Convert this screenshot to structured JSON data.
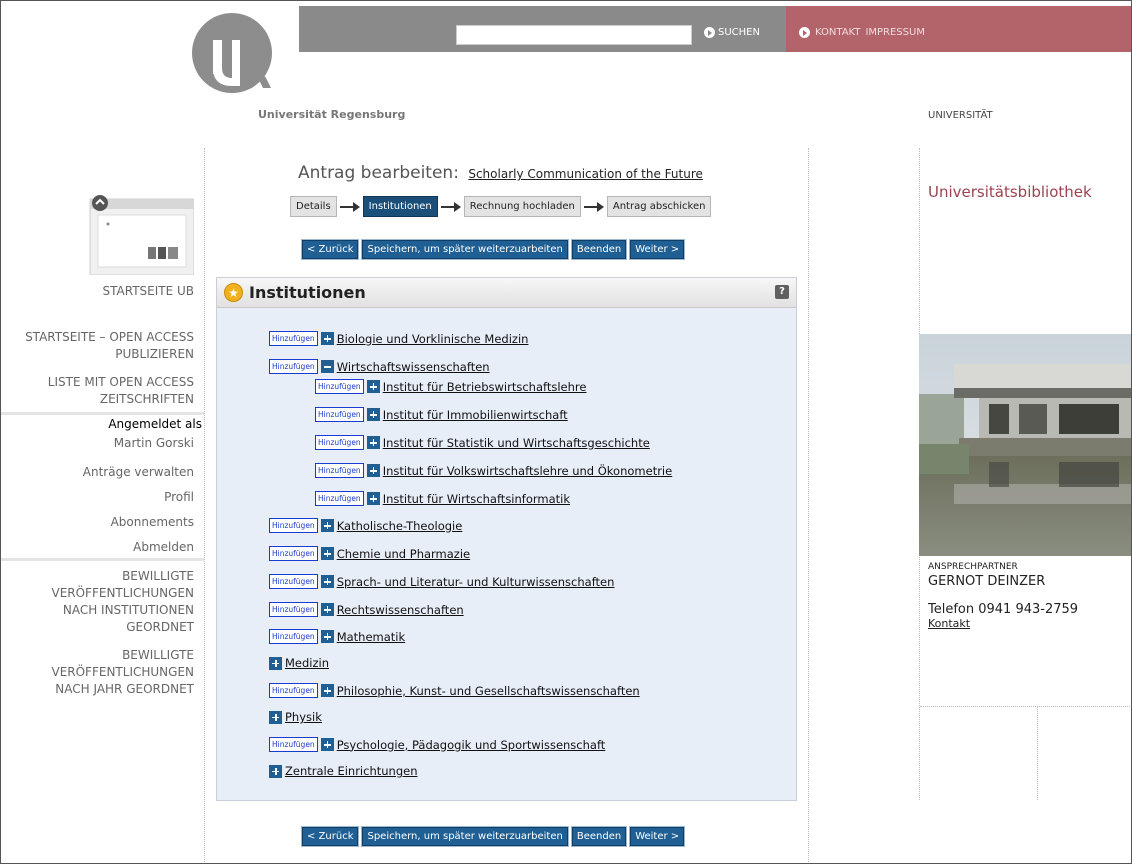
{
  "header": {
    "search_placeholder": "",
    "search_label": "SUCHEN",
    "kontakt_label": "KONTAKT",
    "impressum_label": "IMPRESSUM",
    "logo_text": "Universität Regensburg",
    "universitaet_label": "UNIVERSITÄT"
  },
  "sidebar": {
    "startseite_ub": "STARTSEITE UB",
    "oa_publizieren_1": "STARTSEITE – OPEN ACCESS",
    "oa_publizieren_2": "PUBLIZIEREN",
    "liste_1": "LISTE MIT OPEN ACCESS",
    "liste_2": "ZEITSCHRIFTEN",
    "angemeldet": "Angemeldet als",
    "user": "Martin Gorski",
    "antraege": "Anträge verwalten",
    "profil": "Profil",
    "abonnements": "Abonnements",
    "abmelden": "Abmelden",
    "bew_inst_1": "BEWILLIGTE",
    "bew_inst_2": "VERÖFFENTLICHUNGEN",
    "bew_inst_3": "NACH INSTITUTIONEN",
    "bew_inst_4": "GEORDNET",
    "bew_jahr_1": "BEWILLIGTE",
    "bew_jahr_2": "VERÖFFENTLICHUNGEN",
    "bew_jahr_3": "NACH JAHR GEORDNET"
  },
  "main": {
    "title_prefix": "Antrag bearbeiten:",
    "project_title": "Scholarly Communication of the Future",
    "steps": [
      "Details",
      "Institutionen",
      "Rechnung hochladen",
      "Antrag abschicken"
    ],
    "buttons": {
      "back": "< Zurück",
      "save_later": "Speichern, um später weiterzuarbeiten",
      "finish": "Beenden",
      "next": "Weiter >"
    },
    "panel_title": "Institutionen",
    "help": "?",
    "add_label": "Hinzufügen",
    "tree": [
      "Biologie und Vorklinische Medizin",
      "Wirtschaftswissenschaften",
      "Institut für Betriebswirtschaftslehre",
      "Institut für Immobilienwirtschaft",
      "Institut für Statistik und Wirtschaftsgeschichte",
      "Institut für Volkswirtschaftslehre und Ökonometrie",
      "Institut für Wirtschaftsinformatik",
      "Katholische-Theologie",
      "Chemie und Pharmazie",
      "Sprach- und Literatur- und Kulturwissenschaften",
      "Rechtswissenschaften",
      "Mathematik",
      "Medizin",
      "Philosophie, Kunst- und Gesellschaftswissenschaften",
      "Physik",
      "Psychologie, Pädagogik und Sportwissenschaft",
      "Zentrale Einrichtungen"
    ]
  },
  "right": {
    "ub_title": "Universitätsbibliothek",
    "ansprechpartner": "ANSPRECHPARTNER",
    "contact_name": "GERNOT DEINZER",
    "phone": "Telefon 0941 943-2759",
    "kontakt_link": "Kontakt"
  }
}
